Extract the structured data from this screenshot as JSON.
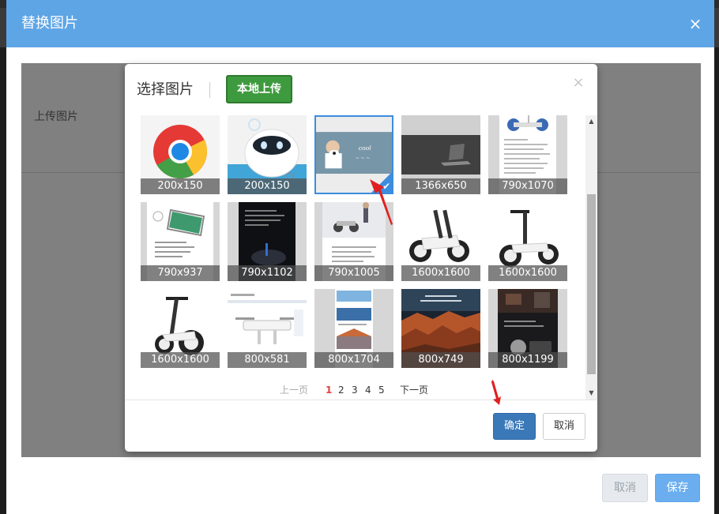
{
  "outer_dialog": {
    "title": "替换图片",
    "close_glyph": "×",
    "upload_label": "上传图片",
    "cancel_label": "取消",
    "save_label": "保存",
    "header_color": "#5ea5e6"
  },
  "picker": {
    "title": "选择图片",
    "local_upload_label": "本地上传",
    "close_glyph": "×",
    "confirm_label": "确定",
    "cancel_label": "取消",
    "accent_color": "#3c8dde"
  },
  "images": [
    {
      "size": "200x150",
      "icon": "chrome-logo",
      "selected": false
    },
    {
      "size": "200x150",
      "icon": "robot-product",
      "selected": false
    },
    {
      "size": "",
      "icon": "person-photo",
      "selected": true
    },
    {
      "size": "1366x650",
      "icon": "laptop-desk-photo",
      "selected": false
    },
    {
      "size": "790x1070",
      "icon": "scooter-spec-page",
      "selected": false
    },
    {
      "size": "790x937",
      "icon": "phone-app-page",
      "selected": false
    },
    {
      "size": "790x1102",
      "icon": "dark-scooter-page",
      "selected": false
    },
    {
      "size": "790x1005",
      "icon": "rider-scooter-page",
      "selected": false
    },
    {
      "size": "1600x1600",
      "icon": "white-scooter",
      "selected": false
    },
    {
      "size": "1600x1600",
      "icon": "white-scooter-handle",
      "selected": false
    },
    {
      "size": "1600x1600",
      "icon": "white-scooter-handle-alt",
      "selected": false
    },
    {
      "size": "800x581",
      "icon": "drone-page",
      "selected": false
    },
    {
      "size": "800x1704",
      "icon": "drone-photo-page",
      "selected": false
    },
    {
      "size": "800x749",
      "icon": "canyon-landscape",
      "selected": false
    },
    {
      "size": "800x1199",
      "icon": "dark-drone-page",
      "selected": false
    }
  ],
  "pagination": {
    "prev_label": "上一页",
    "pages": [
      "1",
      "2",
      "3",
      "4",
      "5"
    ],
    "current_page": "1",
    "next_label": "下一页"
  }
}
